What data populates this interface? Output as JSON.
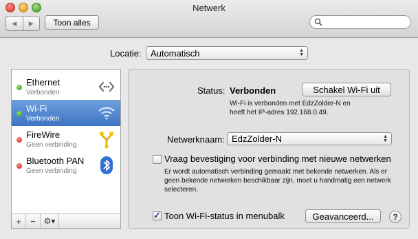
{
  "window": {
    "title": "Netwerk"
  },
  "toolbar": {
    "show_all": "Toon alles",
    "search_placeholder": ""
  },
  "location": {
    "label": "Locatie:",
    "value": "Automatisch"
  },
  "services": [
    {
      "name": "Ethernet",
      "status": "Verbonden",
      "dot": "green",
      "icon": "ethernet-icon"
    },
    {
      "name": "Wi-Fi",
      "status": "Verbonden",
      "dot": "green",
      "icon": "wifi-icon",
      "selected": true
    },
    {
      "name": "FireWire",
      "status": "Geen verbinding",
      "dot": "red",
      "icon": "firewire-icon"
    },
    {
      "name": "Bluetooth PAN",
      "status": "Geen verbinding",
      "dot": "red",
      "icon": "bluetooth-icon"
    }
  ],
  "sidebar_controls": {
    "add": "+",
    "remove": "−",
    "gear": "⚙▾"
  },
  "detail": {
    "status_label": "Status:",
    "status_value": "Verbonden",
    "wifi_off_button": "Schakel Wi-Fi uit",
    "status_desc_line1": "Wi-Fi is verbonden met EdzZolder-N en",
    "status_desc_line2": "heeft het IP-adres 192.168.0.49.",
    "network_name_label": "Netwerknaam:",
    "network_name_value": "EdzZolder-N",
    "ask_join_label": "Vraag bevestiging voor verbinding met nieuwe netwerken",
    "ask_join_checked": false,
    "ask_join_desc_line1": "Er wordt automatisch verbinding gemaakt met bekende netwerken. Als er",
    "ask_join_desc_line2": "geen bekende netwerken beschikbaar zijn, moet u handmatig een netwerk",
    "ask_join_desc_line3": "selecteren.",
    "show_status_label": "Toon Wi-Fi-status in menubalk",
    "show_status_checked": true,
    "advanced_button": "Geavanceerd...",
    "help": "?"
  },
  "colors": {
    "selection": "#3d73c4",
    "connected": "#2f9a13",
    "disconnected": "#cc1d12"
  }
}
